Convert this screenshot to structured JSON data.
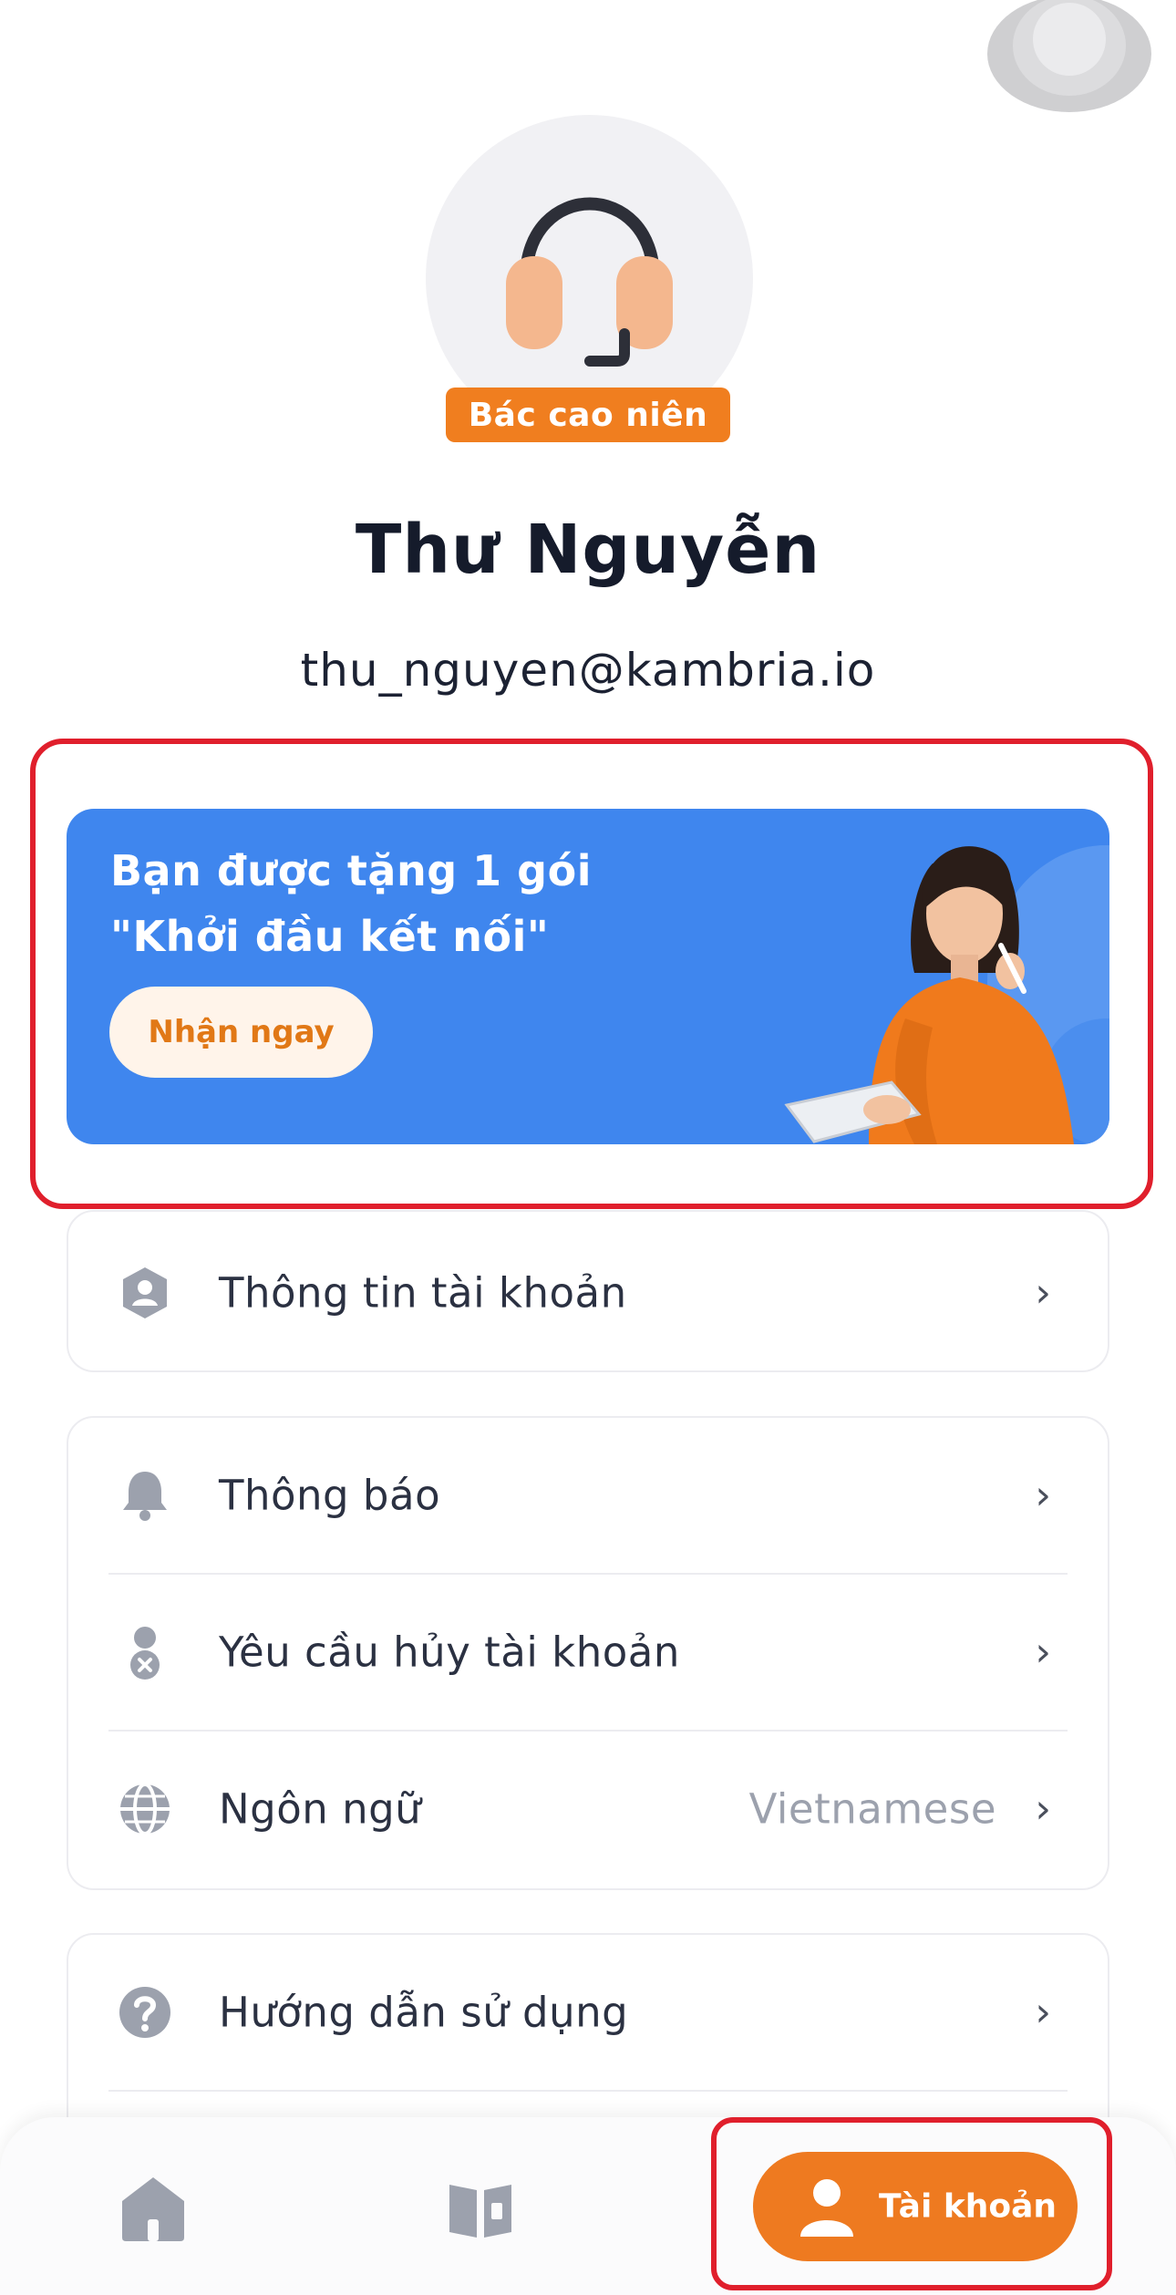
{
  "profile": {
    "role_badge": "Bác cao niên",
    "name": "Thư Nguyễn",
    "email": "thu_nguyen@kambria.io"
  },
  "promo": {
    "title_line1": "Bạn được tặng 1 gói",
    "title_line2": "\"Khởi đầu kết nối\"",
    "cta_label": "Nhận ngay"
  },
  "menu": {
    "account_info": {
      "label": "Thông tin tài khoản",
      "icon": "user-shield-icon"
    },
    "notifications": {
      "label": "Thông báo",
      "icon": "bell-icon"
    },
    "delete_account": {
      "label": "Yêu cầu hủy tài khoản",
      "icon": "user-remove-icon"
    },
    "language": {
      "label": "Ngôn ngữ",
      "value": "Vietnamese",
      "icon": "globe-icon"
    },
    "guide": {
      "label": "Hướng dẫn sử dụng",
      "icon": "question-icon"
    }
  },
  "bottom_nav": {
    "home_icon": "home-icon",
    "library_icon": "book-icon",
    "account_label": "Tài khoản"
  },
  "colors": {
    "accent_orange": "#EE7A20",
    "promo_blue": "#3F86EE",
    "highlight_red": "#E01F2C"
  }
}
